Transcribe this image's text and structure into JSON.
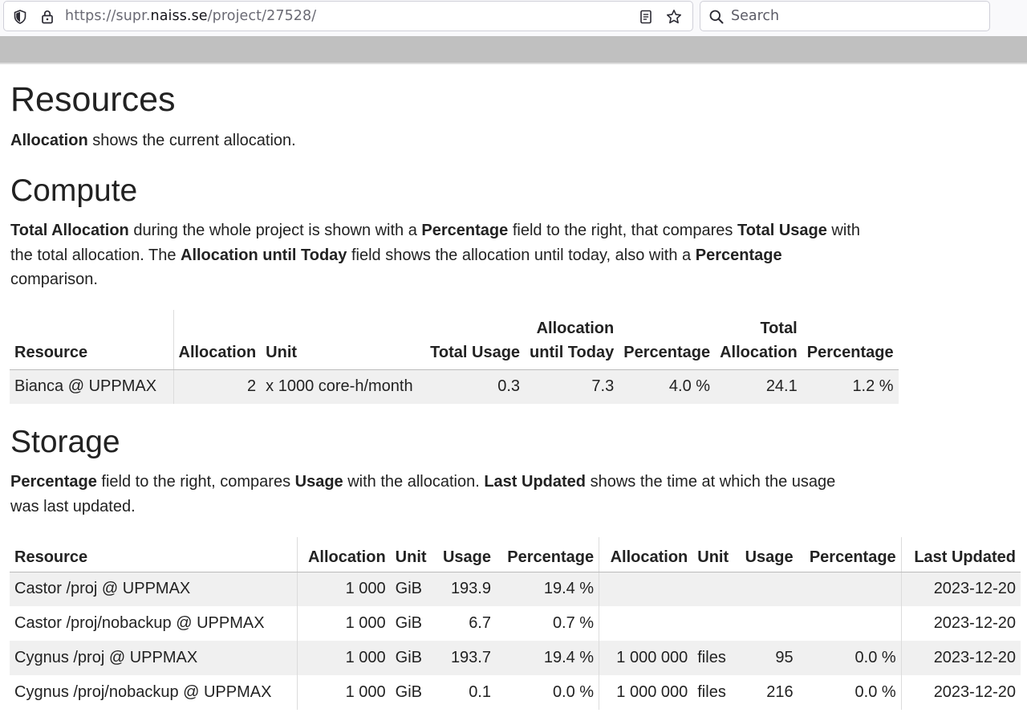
{
  "browser": {
    "url_prefix": "https://supr.",
    "url_host": "naiss.se",
    "url_path": "/project/27528/",
    "search_placeholder": "Search"
  },
  "page": {
    "resources_title": "Resources",
    "resources_desc_bold": "Allocation",
    "resources_desc_rest": " shows the current allocation.",
    "compute_title": "Compute",
    "compute_desc": {
      "b1": "Total Allocation",
      "t1": " during the whole project is shown with a ",
      "b2": "Percentage",
      "t2": " field to the right, that compares ",
      "b3": "Total Usage",
      "t3": " with the total allocation. The ",
      "b4": "Allocation until Today",
      "t4": " field shows the allocation until today, also with a ",
      "b5": "Percentage",
      "t5": " comparison."
    },
    "storage_title": "Storage",
    "storage_desc": {
      "b1": "Percentage",
      "t1": " field to the right, compares ",
      "b2": "Usage",
      "t2": " with the allocation. ",
      "b3": "Last Updated",
      "t3": " shows the time at which the usage was last updated."
    }
  },
  "compute_table": {
    "headers": {
      "resource": "Resource",
      "allocation": "Allocation",
      "unit": "Unit",
      "total_usage": "Total Usage",
      "alloc_today_1": "Allocation",
      "alloc_today_2": "until Today",
      "percentage": "Percentage",
      "total_alloc_1": "Total",
      "total_alloc_2": "Allocation",
      "percentage2": "Percentage"
    },
    "rows": [
      {
        "resource": "Bianca @ UPPMAX",
        "allocation": "2",
        "unit": "x 1000 core-h/month",
        "total_usage": "0.3",
        "alloc_today": "7.3",
        "percentage": "4.0 %",
        "total_allocation": "24.1",
        "percentage2": "1.2 %"
      }
    ]
  },
  "storage_table": {
    "headers": {
      "resource": "Resource",
      "allocation": "Allocation",
      "unit": "Unit",
      "usage": "Usage",
      "percentage": "Percentage",
      "allocation2": "Allocation",
      "unit2": "Unit",
      "usage2": "Usage",
      "percentage2": "Percentage",
      "last_updated": "Last Updated"
    },
    "rows": [
      {
        "resource": "Castor /proj @ UPPMAX",
        "allocation": "1 000",
        "unit": "GiB",
        "usage": "193.9",
        "percentage": "19.4 %",
        "allocation2": "",
        "unit2": "",
        "usage2": "",
        "percentage2": "",
        "last_updated": "2023-12-20"
      },
      {
        "resource": "Castor /proj/nobackup @ UPPMAX",
        "allocation": "1 000",
        "unit": "GiB",
        "usage": "6.7",
        "percentage": "0.7 %",
        "allocation2": "",
        "unit2": "",
        "usage2": "",
        "percentage2": "",
        "last_updated": "2023-12-20"
      },
      {
        "resource": "Cygnus /proj @ UPPMAX",
        "allocation": "1 000",
        "unit": "GiB",
        "usage": "193.7",
        "percentage": "19.4 %",
        "allocation2": "1 000 000",
        "unit2": "files",
        "usage2": "95",
        "percentage2": "0.0 %",
        "last_updated": "2023-12-20"
      },
      {
        "resource": "Cygnus /proj/nobackup @ UPPMAX",
        "allocation": "1 000",
        "unit": "GiB",
        "usage": "0.1",
        "percentage": "0.0 %",
        "allocation2": "1 000 000",
        "unit2": "files",
        "usage2": "216",
        "percentage2": "0.0 %",
        "last_updated": "2023-12-20"
      }
    ]
  }
}
